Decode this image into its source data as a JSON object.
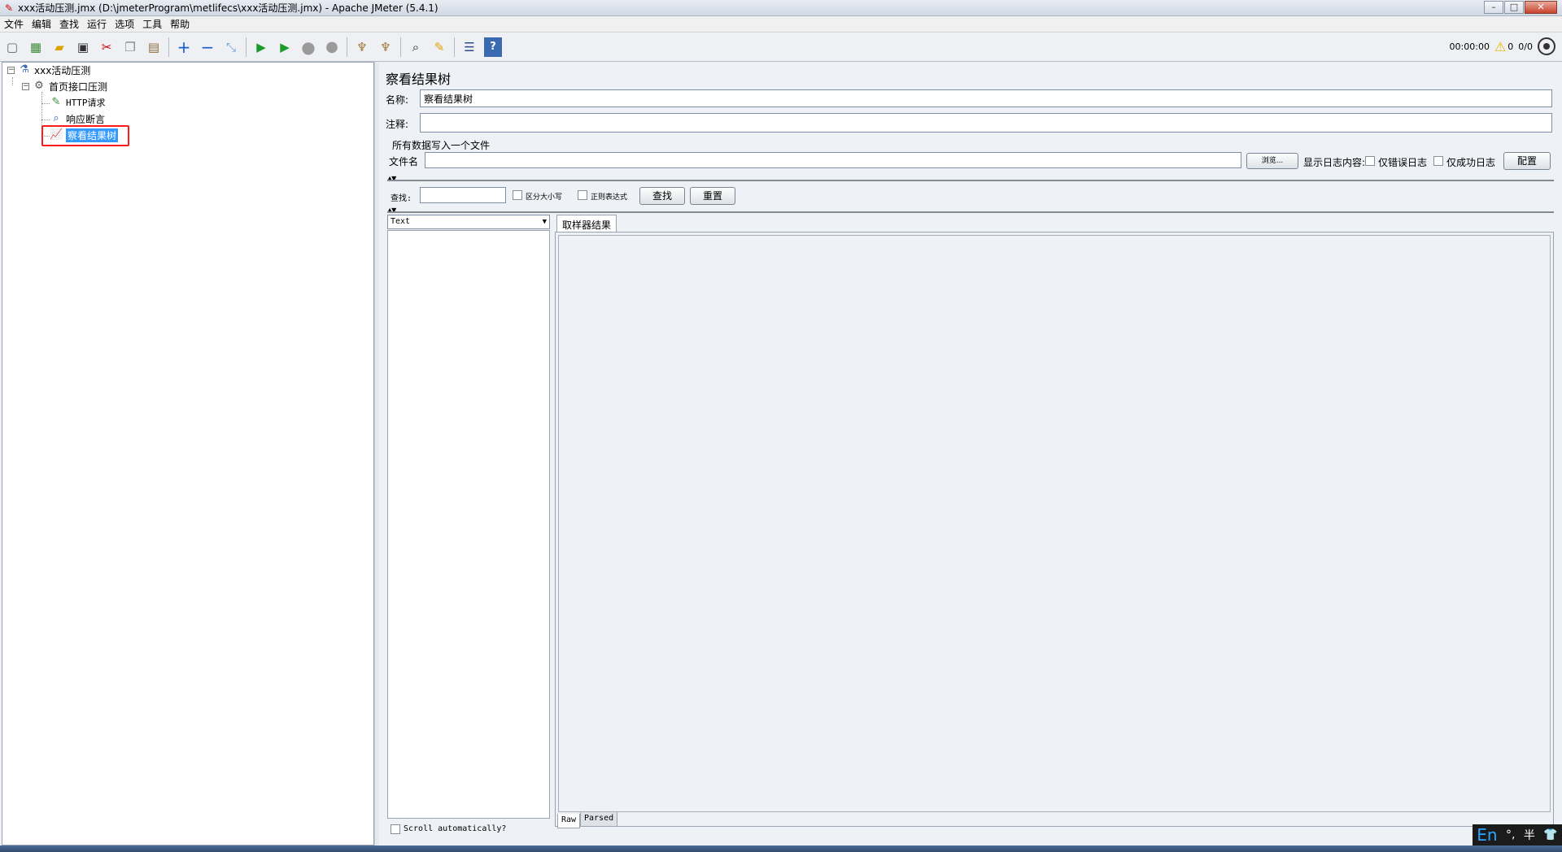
{
  "window": {
    "title": "xxx活动压测.jmx (D:\\jmeterProgram\\metlifecs\\xxx活动压测.jmx) - Apache JMeter (5.4.1)",
    "controls": [
      "minimize-icon",
      "maximize-icon",
      "close-icon"
    ]
  },
  "menu": [
    "文件",
    "编辑",
    "查找",
    "运行",
    "选项",
    "工具",
    "帮助"
  ],
  "toolbar": {
    "icons": [
      "new-icon",
      "templates-icon",
      "open-icon",
      "save-icon",
      "cut-icon",
      "copy-icon",
      "paste-icon",
      "expand-icon",
      "collapse-icon",
      "toggle-icon",
      "start-icon",
      "start-no-pause-icon",
      "stop-icon",
      "shutdown-icon",
      "clear-icon",
      "clear-all-icon",
      "search-icon",
      "reset-search-icon",
      "function-helper-icon",
      "help-icon"
    ],
    "timer": "00:00:00",
    "warning_count": "0",
    "threads": "0/0"
  },
  "tree": {
    "root": "xxx活动压测",
    "thread_group": "首页接口压测",
    "children": [
      "HTTP请求",
      "响应断言",
      "察看结果树"
    ],
    "selected": "察看结果树"
  },
  "panel": {
    "heading": "察看结果树",
    "name_label": "名称:",
    "name_value": "察看结果树",
    "comment_label": "注释:",
    "comment_value": "",
    "file_section_label": "所有数据写入一个文件",
    "filename_label": "文件名",
    "filename_value": "",
    "browse_button": "浏览...",
    "log_contents_label": "显示日志内容:",
    "errors_only_label": "仅错误日志",
    "successes_only_label": "仅成功日志",
    "configure_button": "配置",
    "search_label": "查找:",
    "search_value": "",
    "case_sensitive_label": "区分大小写",
    "regex_label": "正则表达式",
    "find_button": "查找",
    "reset_button": "重置",
    "renderer_selected": "Text",
    "scroll_auto_label": "Scroll automatically?",
    "result_tab": "取样器结果",
    "bottom_tabs": [
      "Raw",
      "Parsed"
    ]
  },
  "ime": {
    "language": "En",
    "mode": "半"
  }
}
